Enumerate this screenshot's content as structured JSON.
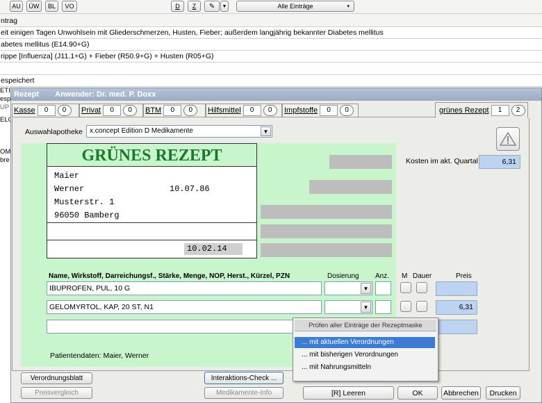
{
  "toolbar": {
    "buttons": [
      "AU",
      "ÜW",
      "BL",
      "VO"
    ],
    "d_label": "D",
    "z_label": "Z",
    "filter_value": "Alle Einträge"
  },
  "background": {
    "rows": [
      "ntrag",
      "eit einigen Tagen Unwohlsein mit Gliederschmerzen, Husten, Fieber; außerdem langjährig bekannter Diabetes mellitus",
      "abetes mellitus (E14.90+G)",
      "rippe [Influenza] (J11.1+G) + Fieber (R50.9+G) + Husten (R05+G)",
      "",
      "espeichert"
    ],
    "side_labels": [
      "ETI",
      "esp",
      "UP",
      "ELC",
      "",
      "OM",
      "bre"
    ]
  },
  "dialog": {
    "title_prefix": "Rezept",
    "title_user": "Anwender: Dr. med. P. Doxx",
    "tabs": [
      {
        "label": "Kasse",
        "count": "0",
        "circle": "0"
      },
      {
        "label": "Privat",
        "count": "0",
        "circle": "0"
      },
      {
        "label": "BTM",
        "count": "0",
        "circle": "0"
      },
      {
        "label": "Hilfsmittel",
        "count": "0",
        "circle": "0"
      },
      {
        "label": "Impfstoffe",
        "count": "0",
        "circle": "0"
      }
    ],
    "gruenes_tab": {
      "label": "grünes Rezept",
      "count": "1",
      "circle": "2"
    },
    "apotheke_label": "Auswahlapotheke",
    "apotheke_value": "x.concept Edition D Medikamente",
    "kosten_label": "Kosten im akt. Quartal",
    "kosten_value": "6,31",
    "form": {
      "title": "GRÜNES REZEPT",
      "patient_lines": [
        "Maier",
        "Werner",
        "Musterstr. 1",
        "96050 Bamberg"
      ],
      "birthdate": "10.07.86",
      "date": "10.02.14"
    },
    "columns": {
      "name": "Name, Wirkstoff, Darreichungsf., Stärke, Menge, NOP, Herst., Kürzel, PZN",
      "dosierung": "Dosierung",
      "anz": "Anz.",
      "m": "M",
      "dauer": "Dauer",
      "preis": "Preis"
    },
    "rows": [
      {
        "name": "IBUPROFEN, PUL, 10 G",
        "price": ""
      },
      {
        "name": "GELOMYRTOL, KAP, 20 ST, N1",
        "price": "6,31"
      },
      {
        "name": "",
        "price": ""
      }
    ],
    "patientendaten": "Patientendaten: Maier, Werner",
    "buttons": {
      "verordnungsblatt": "Verordnungsblatt",
      "preisvergleich": "Preisvergleich",
      "interaktions": "Interaktions-Check ...",
      "medikamente": "Medikamente-Info",
      "leeren": "[R] Leeren",
      "ok": "OK",
      "abbrechen": "Abbrechen",
      "drucken": "Drucken"
    },
    "popup": {
      "header": "Prüfen aller Einträge der Rezeptmaske",
      "items": [
        "... mit aktuellen Verordnungen",
        "... mit bisherigen Verordnungen",
        "... mit Nahrungsmitteln"
      ],
      "selected_index": 0
    },
    "colors": {
      "green_panel": "#c8f5cc",
      "title_bar": "#a9b8cb",
      "form_title": "#1a7a2a",
      "selected": "#3a7bd5"
    }
  }
}
